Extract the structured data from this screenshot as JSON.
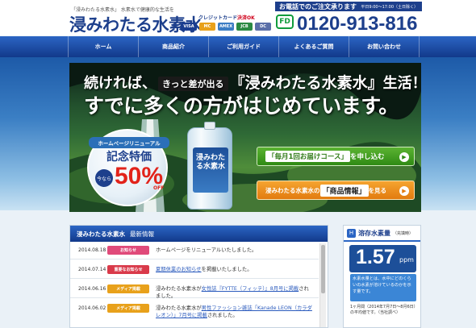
{
  "header": {
    "tagline": "「浸みわたる水素水」 水素水で健康的な生活を",
    "logo": "浸みわたる水素水",
    "card_label_a": "クレジットカード",
    "card_label_b": "決済OK",
    "cards": [
      "VISA",
      "MC",
      "AMEX",
      "JCB",
      "DC"
    ],
    "contact_title": "お電話でのご注文承ります",
    "contact_hours": "平日9:00〜17:00（土日除く）",
    "freedial": "FD",
    "phone": "0120-913-816"
  },
  "nav": {
    "items": [
      "ホーム",
      "商品紹介",
      "ご利用ガイド",
      "よくあるご質問",
      "お問い合わせ"
    ]
  },
  "hero": {
    "line1_a": "続ければ、",
    "line1_mid": "きっと差が出る",
    "line1_brand": "『浸みわたる水素水』",
    "line1_b": "生活！",
    "line2": "すでに多くの方がはじめています。",
    "renewal": "ホームページリニューアル",
    "special": "記念特価",
    "now": "今なら",
    "discount": "50%",
    "off": "OFF",
    "pouch_label": "浸みわたる水素水",
    "btn_monthly_box": "「毎月1回お届けコース」",
    "btn_monthly_tail": "を申し込む",
    "btn_product_head": "浸みわたる水素水の",
    "btn_product_box": "「商品情報」",
    "btn_product_tail": "を見る",
    "arrow": "▶"
  },
  "news": {
    "title": "浸みわたる水素水",
    "subtitle": "最新情報",
    "items": [
      {
        "date": "2014.08.18",
        "tag": "お知らせ",
        "tag_color": "#e04a7a",
        "pre": "ホームページをリニューアルいたしました。",
        "link": "",
        "post": ""
      },
      {
        "date": "2014.07.14",
        "tag": "重要なお知らせ",
        "tag_color": "#d93a4a",
        "pre": "",
        "link": "夏期休業のお知らせ",
        "post": "を掲載いたしました。"
      },
      {
        "date": "2014.06.16",
        "tag": "メディア掲載",
        "tag_color": "#e8a11b",
        "pre": "浸みわたる水素水が",
        "link": "女性誌『FYTTE（フィッテ）』8月号に掲載",
        "post": "されました。"
      },
      {
        "date": "2014.06.02",
        "tag": "メディア掲載",
        "tag_color": "#e8a11b",
        "pre": "浸みわたる水素水が",
        "link": "男性ファッション雑誌「Kanade LEON（カラダレオン）」7月号に掲載",
        "post": "されました。"
      }
    ]
  },
  "sidebar": {
    "icon": "H",
    "title": "溶存水素量",
    "subtitle": "（充填時）",
    "value": "1.57",
    "unit": "ppm",
    "note": "水素水量とは、水中にどのくらいの水素が溶けているのかを示す量です。",
    "caption": "1ヶ月間（2014年7月7日〜8月6日）の平均値です。（当社調べ）"
  }
}
